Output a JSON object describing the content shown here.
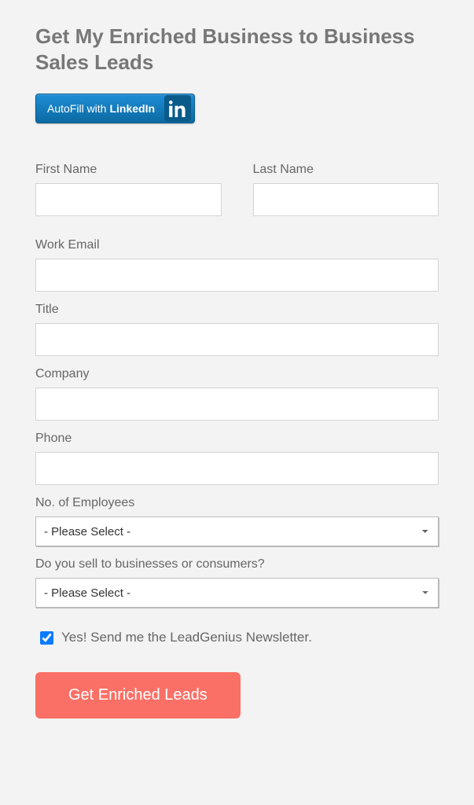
{
  "heading": "Get My Enriched Business to Business Sales Leads",
  "linkedin": {
    "prefix": "AutoFill with ",
    "brand": "LinkedIn"
  },
  "fields": {
    "first_name": {
      "label": "First Name",
      "value": ""
    },
    "last_name": {
      "label": "Last Name",
      "value": ""
    },
    "work_email": {
      "label": "Work Email",
      "value": ""
    },
    "title": {
      "label": "Title",
      "value": ""
    },
    "company": {
      "label": "Company",
      "value": ""
    },
    "phone": {
      "label": "Phone",
      "value": ""
    },
    "employees": {
      "label": "No. of Employees",
      "selected": "- Please Select -"
    },
    "sell_to": {
      "label": "Do you sell to businesses or consumers?",
      "selected": "- Please Select -"
    }
  },
  "newsletter": {
    "checked": true,
    "label": "Yes! Send me the LeadGenius Newsletter."
  },
  "submit": {
    "label": "Get Enriched Leads"
  }
}
